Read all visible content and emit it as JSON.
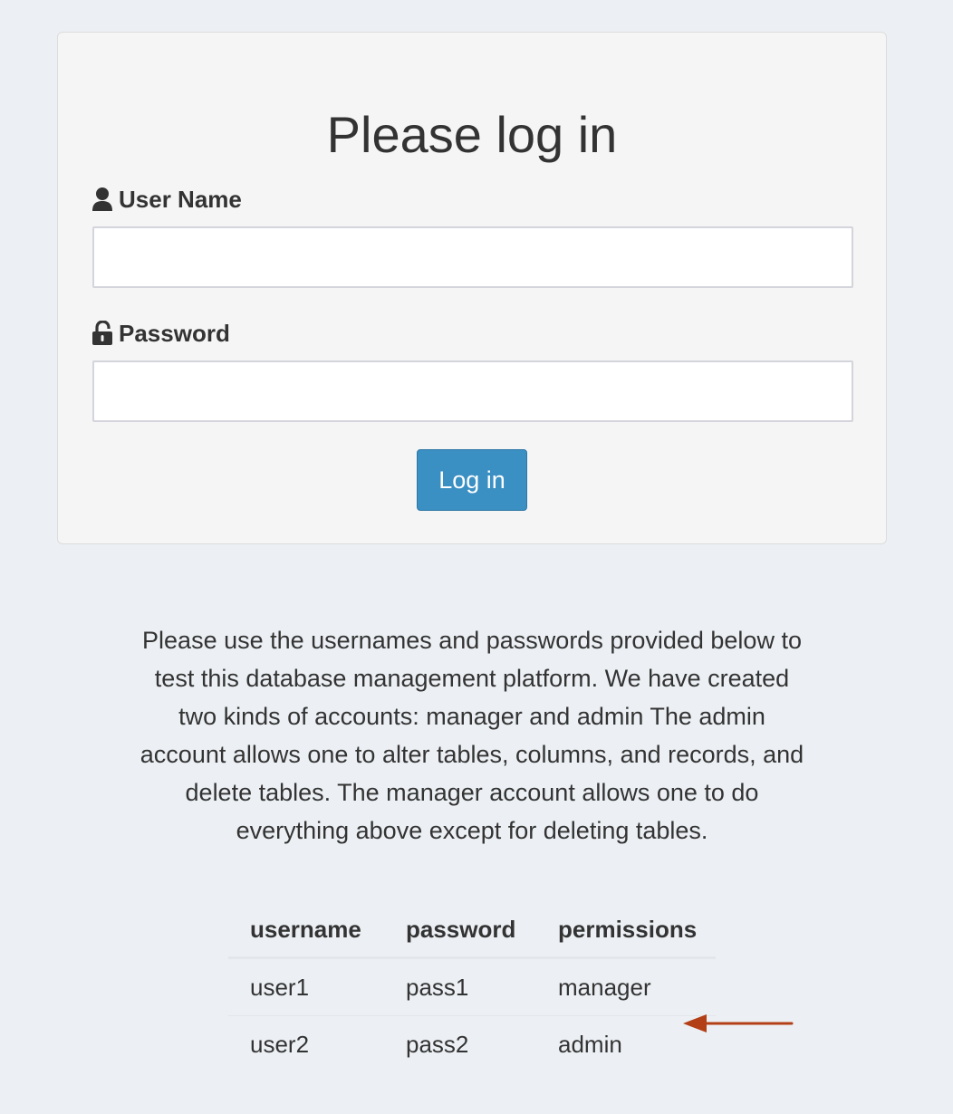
{
  "login": {
    "title": "Please log in",
    "username_label": "User Name",
    "username_value": "",
    "password_label": "Password",
    "password_value": "",
    "submit_label": "Log in"
  },
  "info": {
    "text": "Please use the usernames and passwords provided below to test this database management platform. We have created two kinds of accounts: manager and admin The admin account allows one to alter tables, columns, and records, and delete tables. The manager account allows one to do everything above except for deleting tables."
  },
  "credentials": {
    "headers": [
      "username",
      "password",
      "permissions"
    ],
    "rows": [
      [
        "user1",
        "pass1",
        "manager"
      ],
      [
        "user2",
        "pass2",
        "admin"
      ]
    ]
  },
  "icons": {
    "username": "user-icon",
    "password": "unlock-icon",
    "annotation": "arrow-left-icon"
  },
  "colors": {
    "button": "#3a8fc3",
    "arrow": "#b33f16",
    "background": "#ecf0f4",
    "panel": "#f5f5f5"
  }
}
